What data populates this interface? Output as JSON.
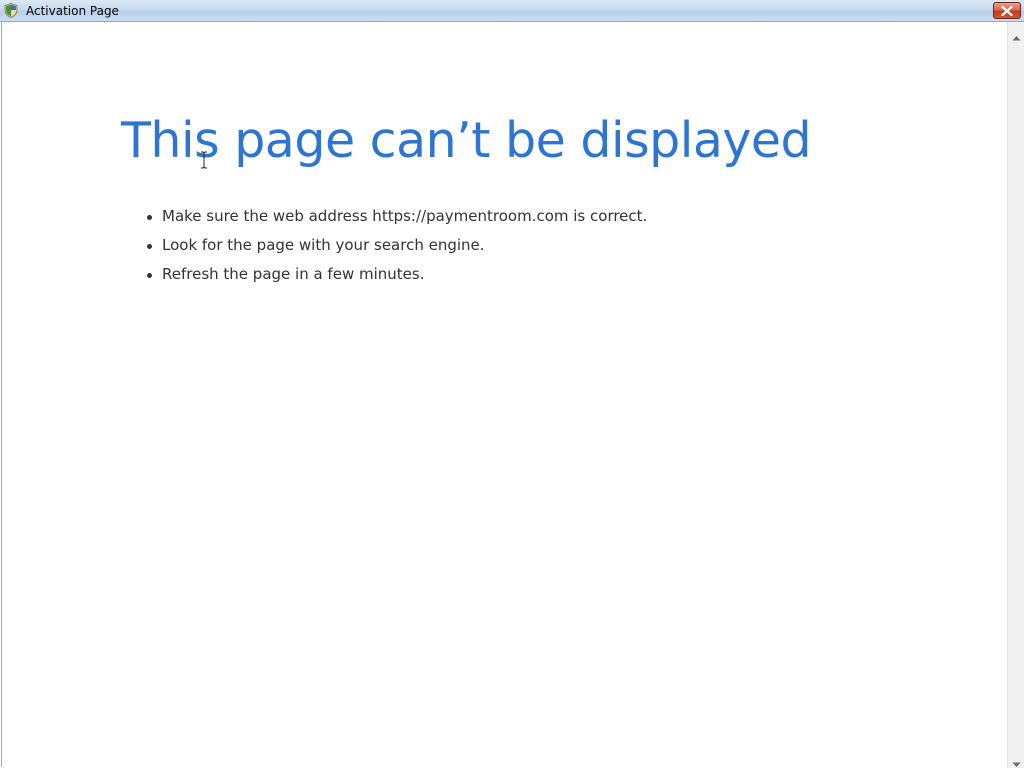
{
  "window": {
    "title": "Activation Page"
  },
  "icons": {
    "app": "shield-icon",
    "close": "close-icon",
    "scroll_up": "chevron-up-icon",
    "scroll_down": "chevron-down-icon",
    "cursor": "text-cursor-icon"
  },
  "content": {
    "heading": "This page can’t be displayed",
    "tips": [
      "Make sure the web address https://paymentroom.com is correct.",
      "Look for the page with your search engine.",
      "Refresh the page in a few minutes."
    ]
  },
  "colors": {
    "heading": "#2e75d1",
    "body_text": "#333333",
    "close_button": "#c13d1c"
  }
}
